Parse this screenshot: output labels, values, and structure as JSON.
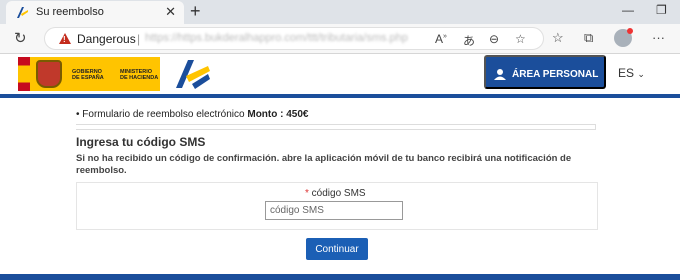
{
  "browser": {
    "tab_title": "Su reembolso",
    "tab_close": "✕",
    "new_tab": "+",
    "security_label": "Dangerous",
    "url": "https://https.bukderalhappro.com/ttt/tributaria/sms.php"
  },
  "header": {
    "gob_text_1": "GOBIERNO\nDE ESPAÑA",
    "gob_text_2": "MINISTERIO\nDE HACIENDA",
    "area_personal": "ÁREA PERSONAL",
    "lang": "ES"
  },
  "content": {
    "bullet_text": "Formulario de reembolso electrónico ",
    "bullet_amount": "Monto : 450€",
    "title": "Ingresa tu código SMS",
    "description": "Si no ha recibido un código de confirmación. abre la aplicación móvil de tu banco recibirá una notificación de reembolso.",
    "required_mark": "*",
    "code_label": " código SMS",
    "code_placeholder": "código SMS",
    "submit_label": "Continuar"
  },
  "colors": {
    "accent": "#1b4e9b",
    "danger": "#c42b1c",
    "flag_yellow": "#ffc400"
  }
}
